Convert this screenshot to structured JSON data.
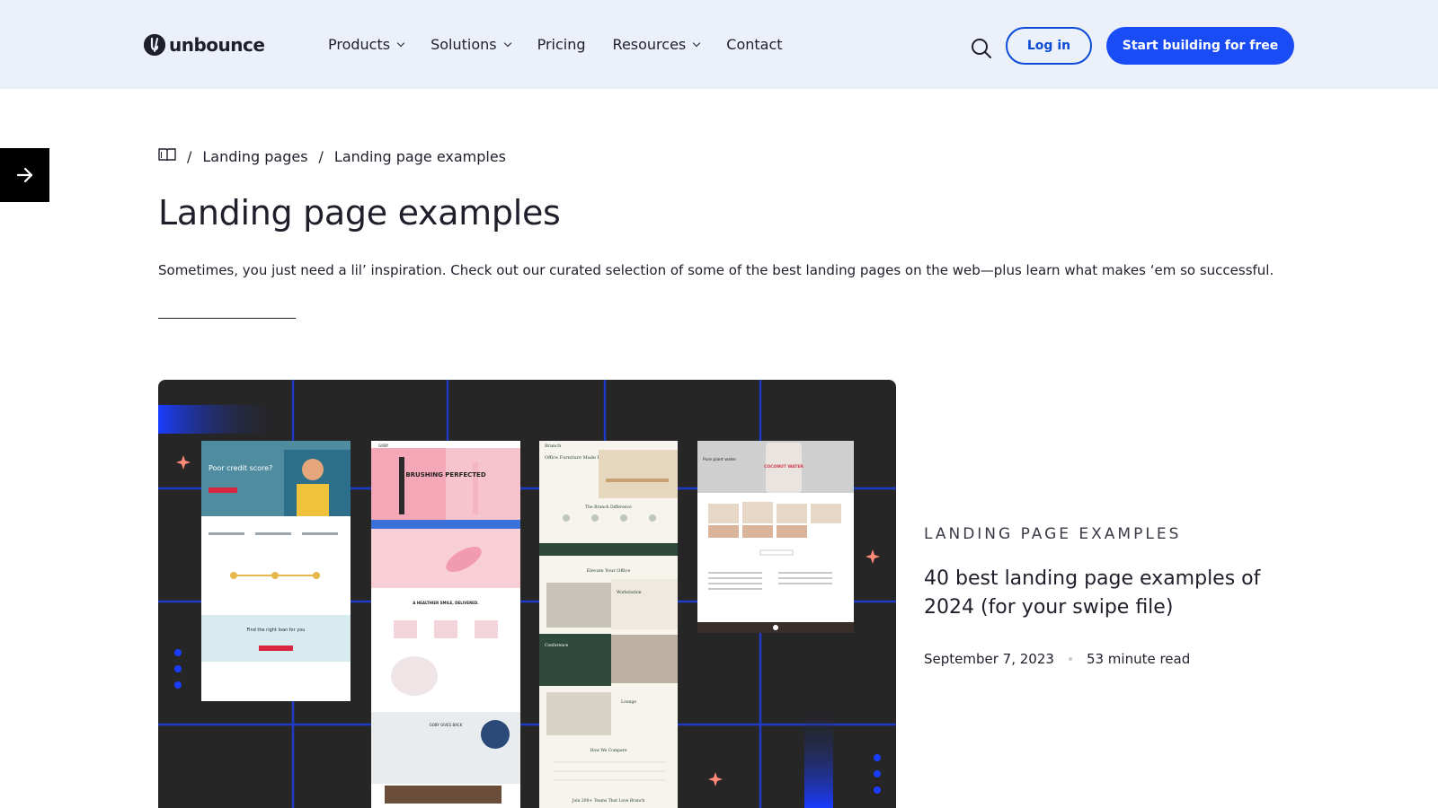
{
  "header": {
    "logo_text": "unbounce",
    "nav": [
      {
        "label": "Products",
        "dropdown": true
      },
      {
        "label": "Solutions",
        "dropdown": true
      },
      {
        "label": "Pricing",
        "dropdown": false
      },
      {
        "label": "Resources",
        "dropdown": true
      },
      {
        "label": "Contact",
        "dropdown": false
      }
    ],
    "login_label": "Log in",
    "start_label": "Start building for free"
  },
  "breadcrumb": {
    "home_icon": "book-icon",
    "items": [
      "Landing pages",
      "Landing page examples"
    ],
    "separator": "/"
  },
  "page": {
    "title": "Landing page examples",
    "intro": "Sometimes, you just need a lil’ inspiration. Check out our curated selection of some of the best landing pages on the web—plus learn what makes ‘em so successful."
  },
  "featured": {
    "eyebrow": "Landing page examples",
    "title": "40 best landing page examples of 2024 (for your swipe file)",
    "date": "September 7, 2023",
    "read_time": "53 minute read",
    "thumbnails": {
      "credit": {
        "headline": "Poor credit score?",
        "cta_heading": "Find the right loan for you"
      },
      "goby": {
        "brand": "GOBY",
        "headline": "BRUSHING PERFECTED",
        "mid": "A HEALTHIER SMILE, DELIVERED.",
        "reviews": "GOBY GIVES BACK"
      },
      "branch": {
        "brand": "Branch",
        "headline": "Office Furniture Made Easy",
        "diff": "The Branch Difference",
        "elevate": "Elevate Your Office",
        "work": "Workstation",
        "conf": "Conference",
        "lounge": "Lounge",
        "compare": "How We Compare",
        "footer": "Join 200+ Teams That Love Branch"
      },
      "water": {
        "headline": "Pure plant water",
        "can_text": "COCONUT WATER"
      }
    }
  },
  "colors": {
    "header_bg": "#ebf0f9",
    "primary_blue": "#1a4cf6",
    "text": "#1f1f2b",
    "card_bg": "#262626",
    "grid_line": "#1f3dd6",
    "sparkle": "#ff8a7a"
  }
}
